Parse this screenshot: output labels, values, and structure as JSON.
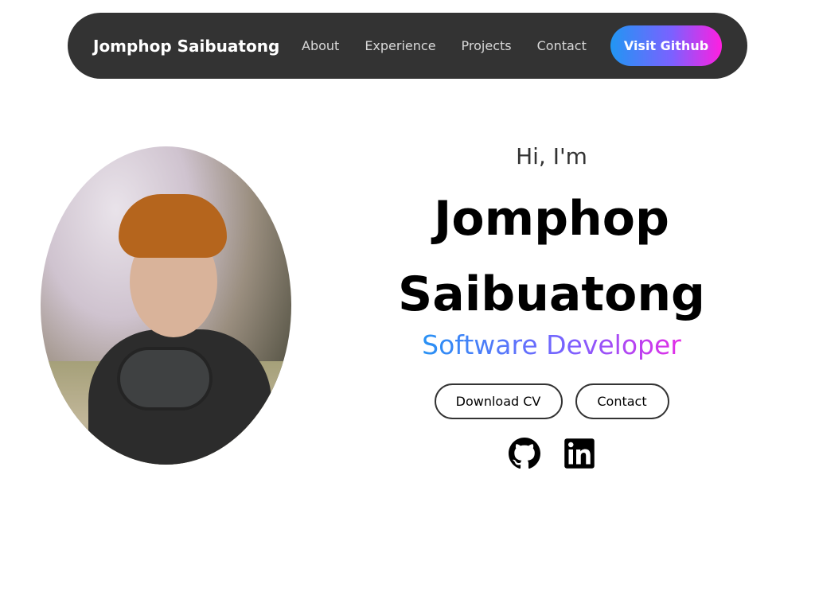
{
  "nav": {
    "brand": "Jomphop Saibuatong",
    "links": [
      "About",
      "Experience",
      "Projects",
      "Contact"
    ],
    "cta": "Visit Github"
  },
  "hero": {
    "greeting": "Hi, I'm",
    "name_line1": "Jomphop",
    "name_line2": "Saibuatong",
    "role": "Software Developer",
    "buttons": {
      "cv": "Download CV",
      "contact": "Contact"
    },
    "socials": [
      "github-icon",
      "linkedin-icon"
    ]
  },
  "colors": {
    "nav_bg": "#333333",
    "gradient_start": "#2196f3",
    "gradient_mid": "#7b61ff",
    "gradient_end": "#ff1fe0",
    "text_dark": "#000000"
  }
}
